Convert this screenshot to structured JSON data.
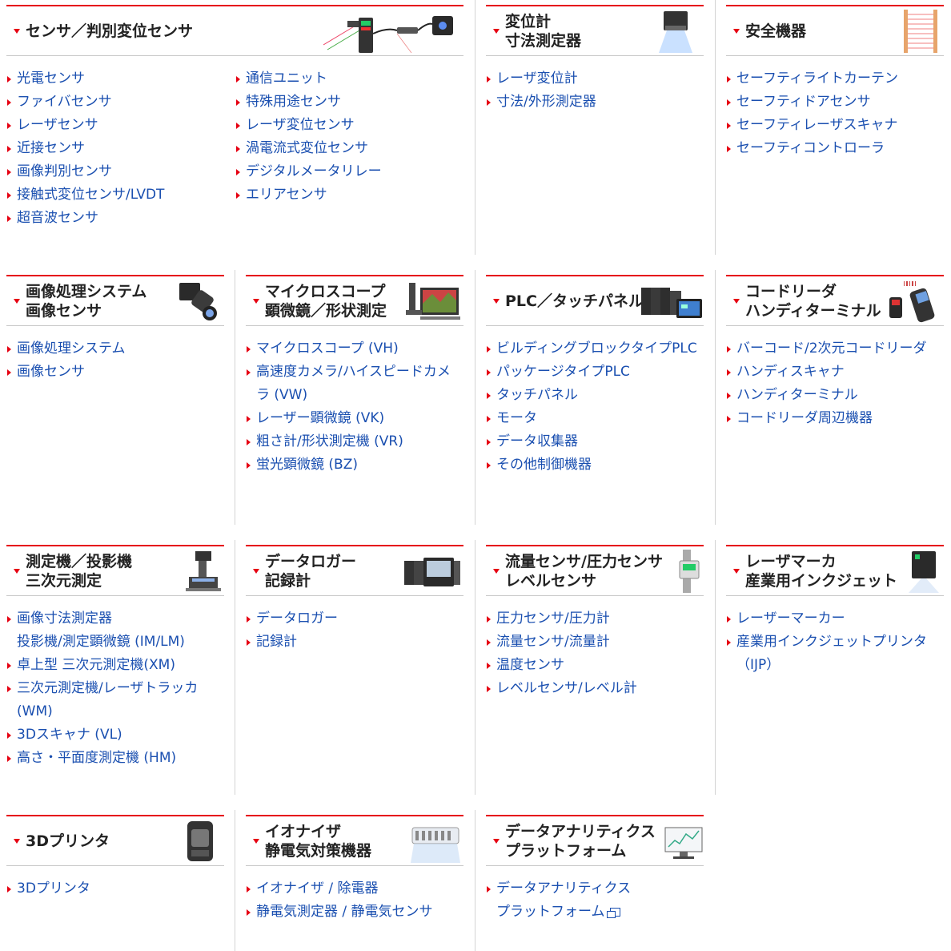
{
  "categories": [
    {
      "title": "センサ／判別変位センサ",
      "links": [
        "光電センサ",
        "ファイバセンサ",
        "レーザセンサ",
        "近接センサ",
        "画像判別センサ",
        "接触式変位センサ/LVDT",
        "超音波センサ",
        "通信ユニット",
        "特殊用途センサ",
        "レーザ変位センサ",
        "渦電流式変位センサ",
        "デジタルメータリレー",
        "エリアセンサ"
      ]
    },
    {
      "title": "変位計\n寸法測定器",
      "links": [
        "レーザ変位計",
        "寸法/外形測定器"
      ]
    },
    {
      "title": "安全機器",
      "links": [
        "セーフティライトカーテン",
        "セーフティドアセンサ",
        "セーフティレーザスキャナ",
        "セーフティコントローラ"
      ]
    },
    {
      "title": "画像処理システム\n画像センサ",
      "links": [
        "画像処理システム",
        "画像センサ"
      ]
    },
    {
      "title": "マイクロスコープ\n顕微鏡／形状測定",
      "links": [
        "マイクロスコープ (VH)",
        "高速度カメラ/ハイスピードカメ\nラ (VW)",
        "レーザー顕微鏡 (VK)",
        "粗さ計/形状測定機 (VR)",
        "蛍光顕微鏡 (BZ)"
      ]
    },
    {
      "title": "PLC／タッチパネル",
      "links": [
        "ビルディングブロックタイプPLC",
        "パッケージタイプPLC",
        "タッチパネル",
        "モータ",
        "データ収集器",
        "その他制御機器"
      ]
    },
    {
      "title": "コードリーダ\nハンディターミナル",
      "links": [
        "バーコード/2次元コードリーダ",
        "ハンディスキャナ",
        "ハンディターミナル",
        "コードリーダ周辺機器"
      ]
    },
    {
      "title": "測定機／投影機\n三次元測定",
      "links": [
        "画像寸法測定器\n投影機/測定顕微鏡 (IM/LM)",
        "卓上型 三次元測定機(XM)",
        "三次元測定機/レーザトラッカ\n(WM)",
        "3Dスキャナ (VL)",
        "高さ・平面度測定機 (HM)"
      ]
    },
    {
      "title": "データロガー\n記録計",
      "links": [
        "データロガー",
        "記録計"
      ]
    },
    {
      "title": "流量センサ/圧力センサ\nレベルセンサ",
      "links": [
        "圧力センサ/圧力計",
        "流量センサ/流量計",
        "温度センサ",
        "レベルセンサ/レベル計"
      ]
    },
    {
      "title": "レーザマーカ\n産業用インクジェット",
      "links": [
        "レーザーマーカー",
        "産業用インクジェットプリンタ\n（IJP）"
      ]
    },
    {
      "title": "3Dプリンタ",
      "links": [
        "3Dプリンタ"
      ]
    },
    {
      "title": "イオナイザ\n静電気対策機器",
      "links": [
        "イオナイザ / 除電器",
        "静電気測定器 / 静電気センサ"
      ]
    },
    {
      "title": "データアナリティクス\nプラットフォーム",
      "links": [
        "データアナリティクス\nプラットフォーム"
      ]
    }
  ],
  "colors": {
    "accent": "#e60012",
    "link": "#1a4fb0",
    "text": "#222222",
    "divider": "#d4d4d4"
  },
  "icons": [
    "red-triangle-down-icon",
    "red-arrow-right-icon",
    "external-window-icon"
  ]
}
